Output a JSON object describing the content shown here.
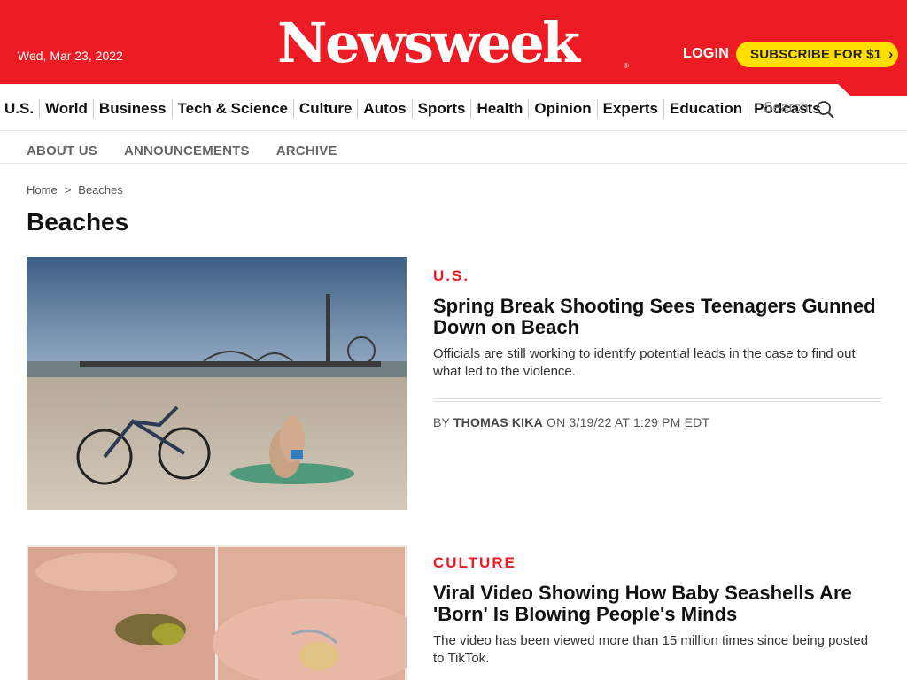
{
  "header": {
    "date": "Wed, Mar 23, 2022",
    "logo": "Newsweek",
    "logo_reg": "®",
    "login": "LOGIN",
    "subscribe": "SUBSCRIBE FOR $1",
    "subscribe_chevron": "›",
    "brand_color": "#ed1c24",
    "subscribe_color": "#ffde00"
  },
  "nav": {
    "items": [
      "U.S.",
      "World",
      "Business",
      "Tech & Science",
      "Culture",
      "Autos",
      "Sports",
      "Health",
      "Opinion",
      "Experts",
      "Education",
      "Podcasts"
    ],
    "search_label": "Search",
    "search_icon": "magnifier-icon"
  },
  "subnav": {
    "items": [
      "ABOUT US",
      "ANNOUNCEMENTS",
      "ARCHIVE"
    ]
  },
  "breadcrumb": {
    "home": "Home",
    "separator": ">",
    "current": "Beaches"
  },
  "page": {
    "title": "Beaches"
  },
  "articles": [
    {
      "category": "U.S.",
      "headline": "Spring Break Shooting Sees Teenagers Gunned Down on Beach",
      "summary": "Officials are still working to identify potential leads in the case to find out what led to the violence.",
      "byline_prefix": "BY",
      "author": "THOMAS KIKA",
      "byline_suffix": "ON 3/19/22 AT 1:29 PM EDT"
    },
    {
      "category": "CULTURE",
      "headline": "Viral Video Showing How Baby Seashells Are 'Born' Is Blowing People's Minds",
      "summary": "The video has been viewed more than 15 million times since being posted to TikTok."
    }
  ]
}
